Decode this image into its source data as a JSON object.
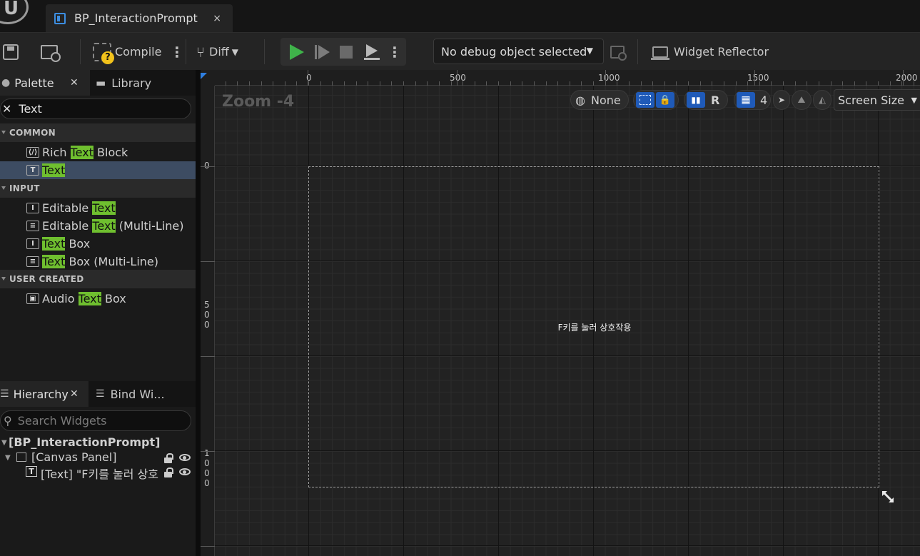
{
  "document_tab": {
    "title": "BP_InteractionPrompt",
    "close": "×"
  },
  "toolbar": {
    "compile_label": "Compile",
    "diff_label": "Diff",
    "debug_object": "No debug object selected",
    "widget_reflector_label": "Widget Reflector"
  },
  "palette": {
    "tab_label": "Palette",
    "library_tab_label": "Library",
    "search_value": "Text",
    "categories": [
      {
        "name": "COMMON",
        "items": [
          {
            "before": "Rich ",
            "match": "Text",
            "after": " Block",
            "icon": "rich-text-icon"
          },
          {
            "before": "",
            "match": "Text",
            "after": "",
            "icon": "text-icon"
          }
        ]
      },
      {
        "name": "INPUT",
        "items": [
          {
            "before": "Editable ",
            "match": "Text",
            "after": "",
            "icon": "editable-text-icon"
          },
          {
            "before": "Editable ",
            "match": "Text",
            "after": " (Multi-Line)",
            "icon": "multiline-text-icon"
          },
          {
            "before": "",
            "match": "Text",
            "after": " Box",
            "icon": "text-box-icon"
          },
          {
            "before": "",
            "match": "Text",
            "after": " Box (Multi-Line)",
            "icon": "multiline-text-box-icon"
          }
        ]
      },
      {
        "name": "USER CREATED",
        "items": [
          {
            "before": "Audio ",
            "match": "Text",
            "after": " Box",
            "icon": "user-widget-icon"
          }
        ]
      }
    ]
  },
  "hierarchy": {
    "tab_label": "Hierarchy",
    "bind_tab_label": "Bind Wi...",
    "search_placeholder": "Search Widgets",
    "root": "[BP_InteractionPrompt]",
    "canvas": "[Canvas Panel]",
    "text_item": "[Text] \"F키를 눌러 상호"
  },
  "designer": {
    "zoom_label": "Zoom -4",
    "locale_label": "None",
    "r_label": "R",
    "grid_snap": "4",
    "screen_size_label": "Screen Size",
    "ruler_top": [
      "0",
      "500",
      "1000",
      "1500",
      "2000"
    ],
    "ruler_left": [
      "0",
      "5\n0\n0",
      "1\n0\n0\n0"
    ],
    "prompt_text": "F키를 눌러 상호작용"
  },
  "colors": {
    "accent_blue": "#1f5ab8",
    "search_highlight": "#6fbf2f",
    "play_green": "#3fb34a",
    "selected_row": "#3d4c62"
  }
}
